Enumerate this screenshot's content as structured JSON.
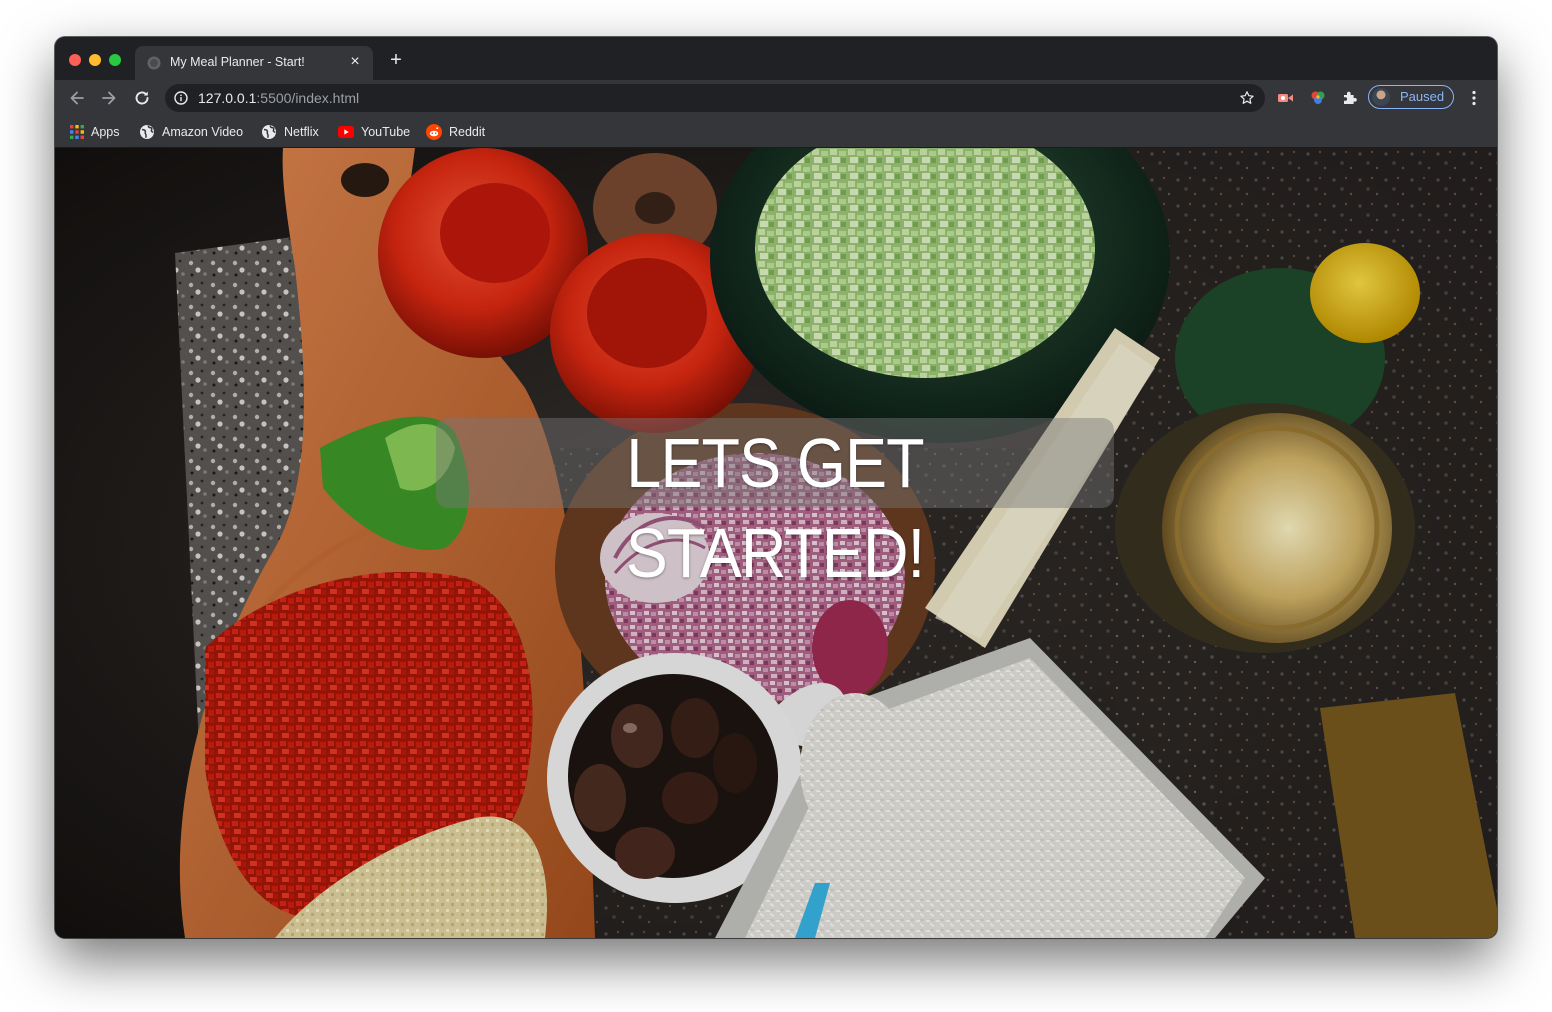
{
  "window": {
    "tab_title": "My Meal Planner - Start!",
    "tab_close": "×",
    "new_tab": "+"
  },
  "toolbar": {
    "url_host": "127.0.0.1",
    "url_rest": ":5500/index.html",
    "profile_label": "Paused"
  },
  "bookmarks": [
    {
      "label": "Apps",
      "icon": "apps-grid-icon"
    },
    {
      "label": "Amazon Video",
      "icon": "globe-icon"
    },
    {
      "label": "Netflix",
      "icon": "globe-icon"
    },
    {
      "label": "YouTube",
      "icon": "youtube-icon"
    },
    {
      "label": "Reddit",
      "icon": "reddit-icon"
    }
  ],
  "page": {
    "headline": "LETS GET STARTED!",
    "background": "overhead photo of food prep: tomatoes, cucumber, onion, peppers, olives, rice, cheese, jar"
  },
  "colors": {
    "chrome_dark": "#202124",
    "chrome_toolbar": "#35363a",
    "accent_blue": "#8ab4f8",
    "text_light": "#e8eaed"
  }
}
